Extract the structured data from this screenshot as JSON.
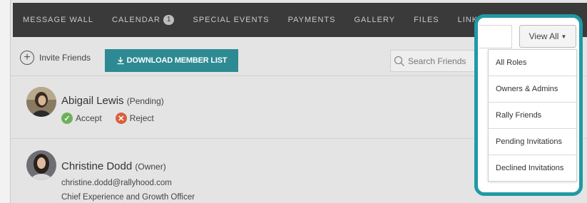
{
  "nav": {
    "items": [
      {
        "label": "MESSAGE WALL"
      },
      {
        "label": "CALENDAR",
        "badge": "1"
      },
      {
        "label": "SPECIAL EVENTS"
      },
      {
        "label": "PAYMENTS"
      },
      {
        "label": "GALLERY"
      },
      {
        "label": "FILES"
      },
      {
        "label": "LINKS"
      }
    ]
  },
  "toolbar": {
    "invite_label": "Invite Friends",
    "download_label": "DOWNLOAD MEMBER LIST",
    "search_placeholder": "Search Friends"
  },
  "members": [
    {
      "name": "Abigail Lewis",
      "role": "(Pending)",
      "accept_label": "Accept",
      "reject_label": "Reject"
    },
    {
      "name": "Christine Dodd",
      "role": "(Owner)",
      "email": "christine.dodd@rallyhood.com",
      "title": "Chief Experience and Growth Officer"
    }
  ],
  "filter": {
    "button_label": "View All",
    "options": [
      "All Roles",
      "Owners & Admins",
      "Rally Friends",
      "Pending Invitations",
      "Declined Invitations"
    ]
  },
  "colors": {
    "accent": "#2d8a93",
    "highlight": "#1f9aa5",
    "nav_bg": "#3a3a3a",
    "accept": "#6cb15a",
    "reject": "#d8603d"
  }
}
